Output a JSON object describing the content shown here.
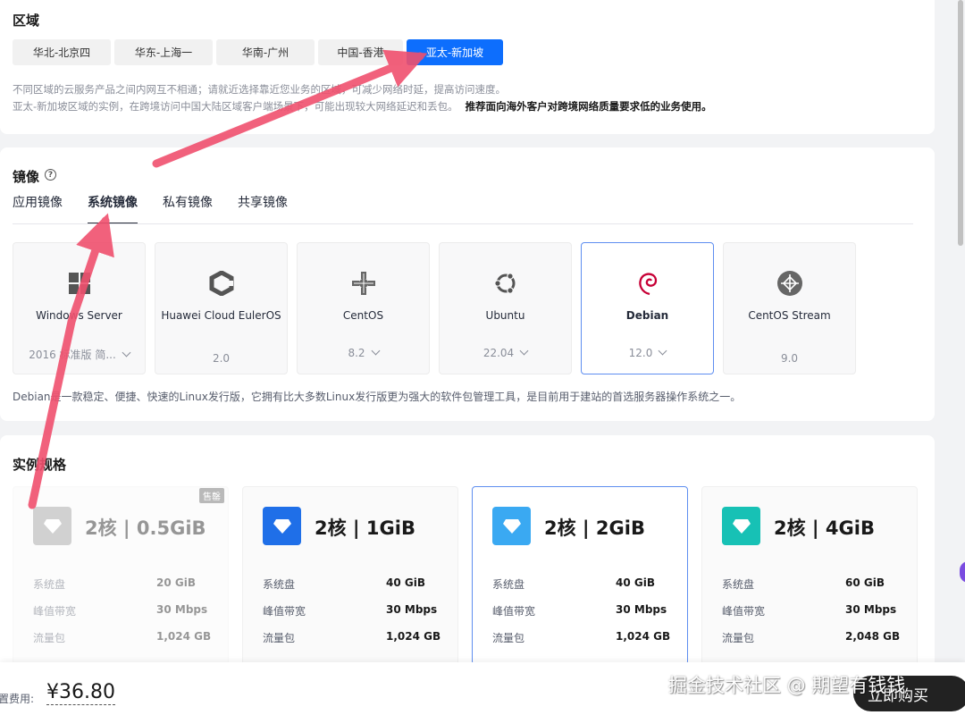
{
  "region": {
    "title": "区域",
    "tabs": [
      "华北-北京四",
      "华东-上海一",
      "华南-广州",
      "中国-香港",
      "亚太-新加坡"
    ],
    "active_index": 4,
    "note1": "不同区域的云服务产品之间内网互不相通；请就近选择靠近您业务的区域，可减少网络时延，提高访问速度。",
    "note2": "亚太-新加坡区域的实例，在跨境访问中国大陆区域客户端场景下，可能出现较大网络延迟和丢包。",
    "note2_bold": "推荐面向海外客户对跨境网络质量要求低的业务使用。"
  },
  "image": {
    "title": "镜像",
    "help_icon": "question-circle-icon",
    "tabs": [
      "应用镜像",
      "系统镜像",
      "私有镜像",
      "共享镜像"
    ],
    "active_tab": 1,
    "os": [
      {
        "name": "Windows Server",
        "version": "2016 标准版 简...",
        "has_dropdown": true,
        "icon": "windows-icon"
      },
      {
        "name": "Huawei Cloud EulerOS",
        "version": "2.0",
        "has_dropdown": false,
        "icon": "euleros-icon"
      },
      {
        "name": "CentOS",
        "version": "8.2",
        "has_dropdown": true,
        "icon": "centos-icon"
      },
      {
        "name": "Ubuntu",
        "version": "22.04",
        "has_dropdown": true,
        "icon": "ubuntu-icon"
      },
      {
        "name": "Debian",
        "version": "12.0",
        "has_dropdown": true,
        "icon": "debian-icon",
        "selected": true
      },
      {
        "name": "CentOS Stream",
        "version": "9.0",
        "has_dropdown": false,
        "icon": "centos-stream-icon"
      }
    ],
    "description": "Debian是一款稳定、便捷、快速的Linux发行版，它拥有比大多数Linux发行版更为强大的软件包管理工具，是目前用于建站的首选服务器操作系统之一。"
  },
  "spec": {
    "title": "实例规格",
    "sold_out_label": "售罄",
    "row_labels": [
      "系统盘",
      "峰值带宽",
      "流量包"
    ],
    "cards": [
      {
        "title": "2核 | 0.5GiB",
        "disk": "20 GiB",
        "bandwidth": "30 Mbps",
        "traffic": "1,024 GB",
        "sold_out": true,
        "color": "#9a9a9a"
      },
      {
        "title": "2核 | 1GiB",
        "disk": "40 GiB",
        "bandwidth": "30 Mbps",
        "traffic": "1,024 GB",
        "color": "#1f6fe8"
      },
      {
        "title": "2核 | 2GiB",
        "disk": "40 GiB",
        "bandwidth": "30 Mbps",
        "traffic": "1,024 GB",
        "selected": true,
        "color": "#3aa9f2"
      },
      {
        "title": "2核 | 4GiB",
        "disk": "60 GiB",
        "bandwidth": "30 Mbps",
        "traffic": "2,048 GB",
        "color": "#17c1b5"
      }
    ]
  },
  "footer": {
    "fee_label": "置费用:",
    "fee_value": "¥36.80",
    "buy_label": "立即购买",
    "watermark": "掘金技术社区 @ 期望有钱钱"
  },
  "colors": {
    "accent": "#0d6efd",
    "annotation_arrow": "#f0506e"
  }
}
